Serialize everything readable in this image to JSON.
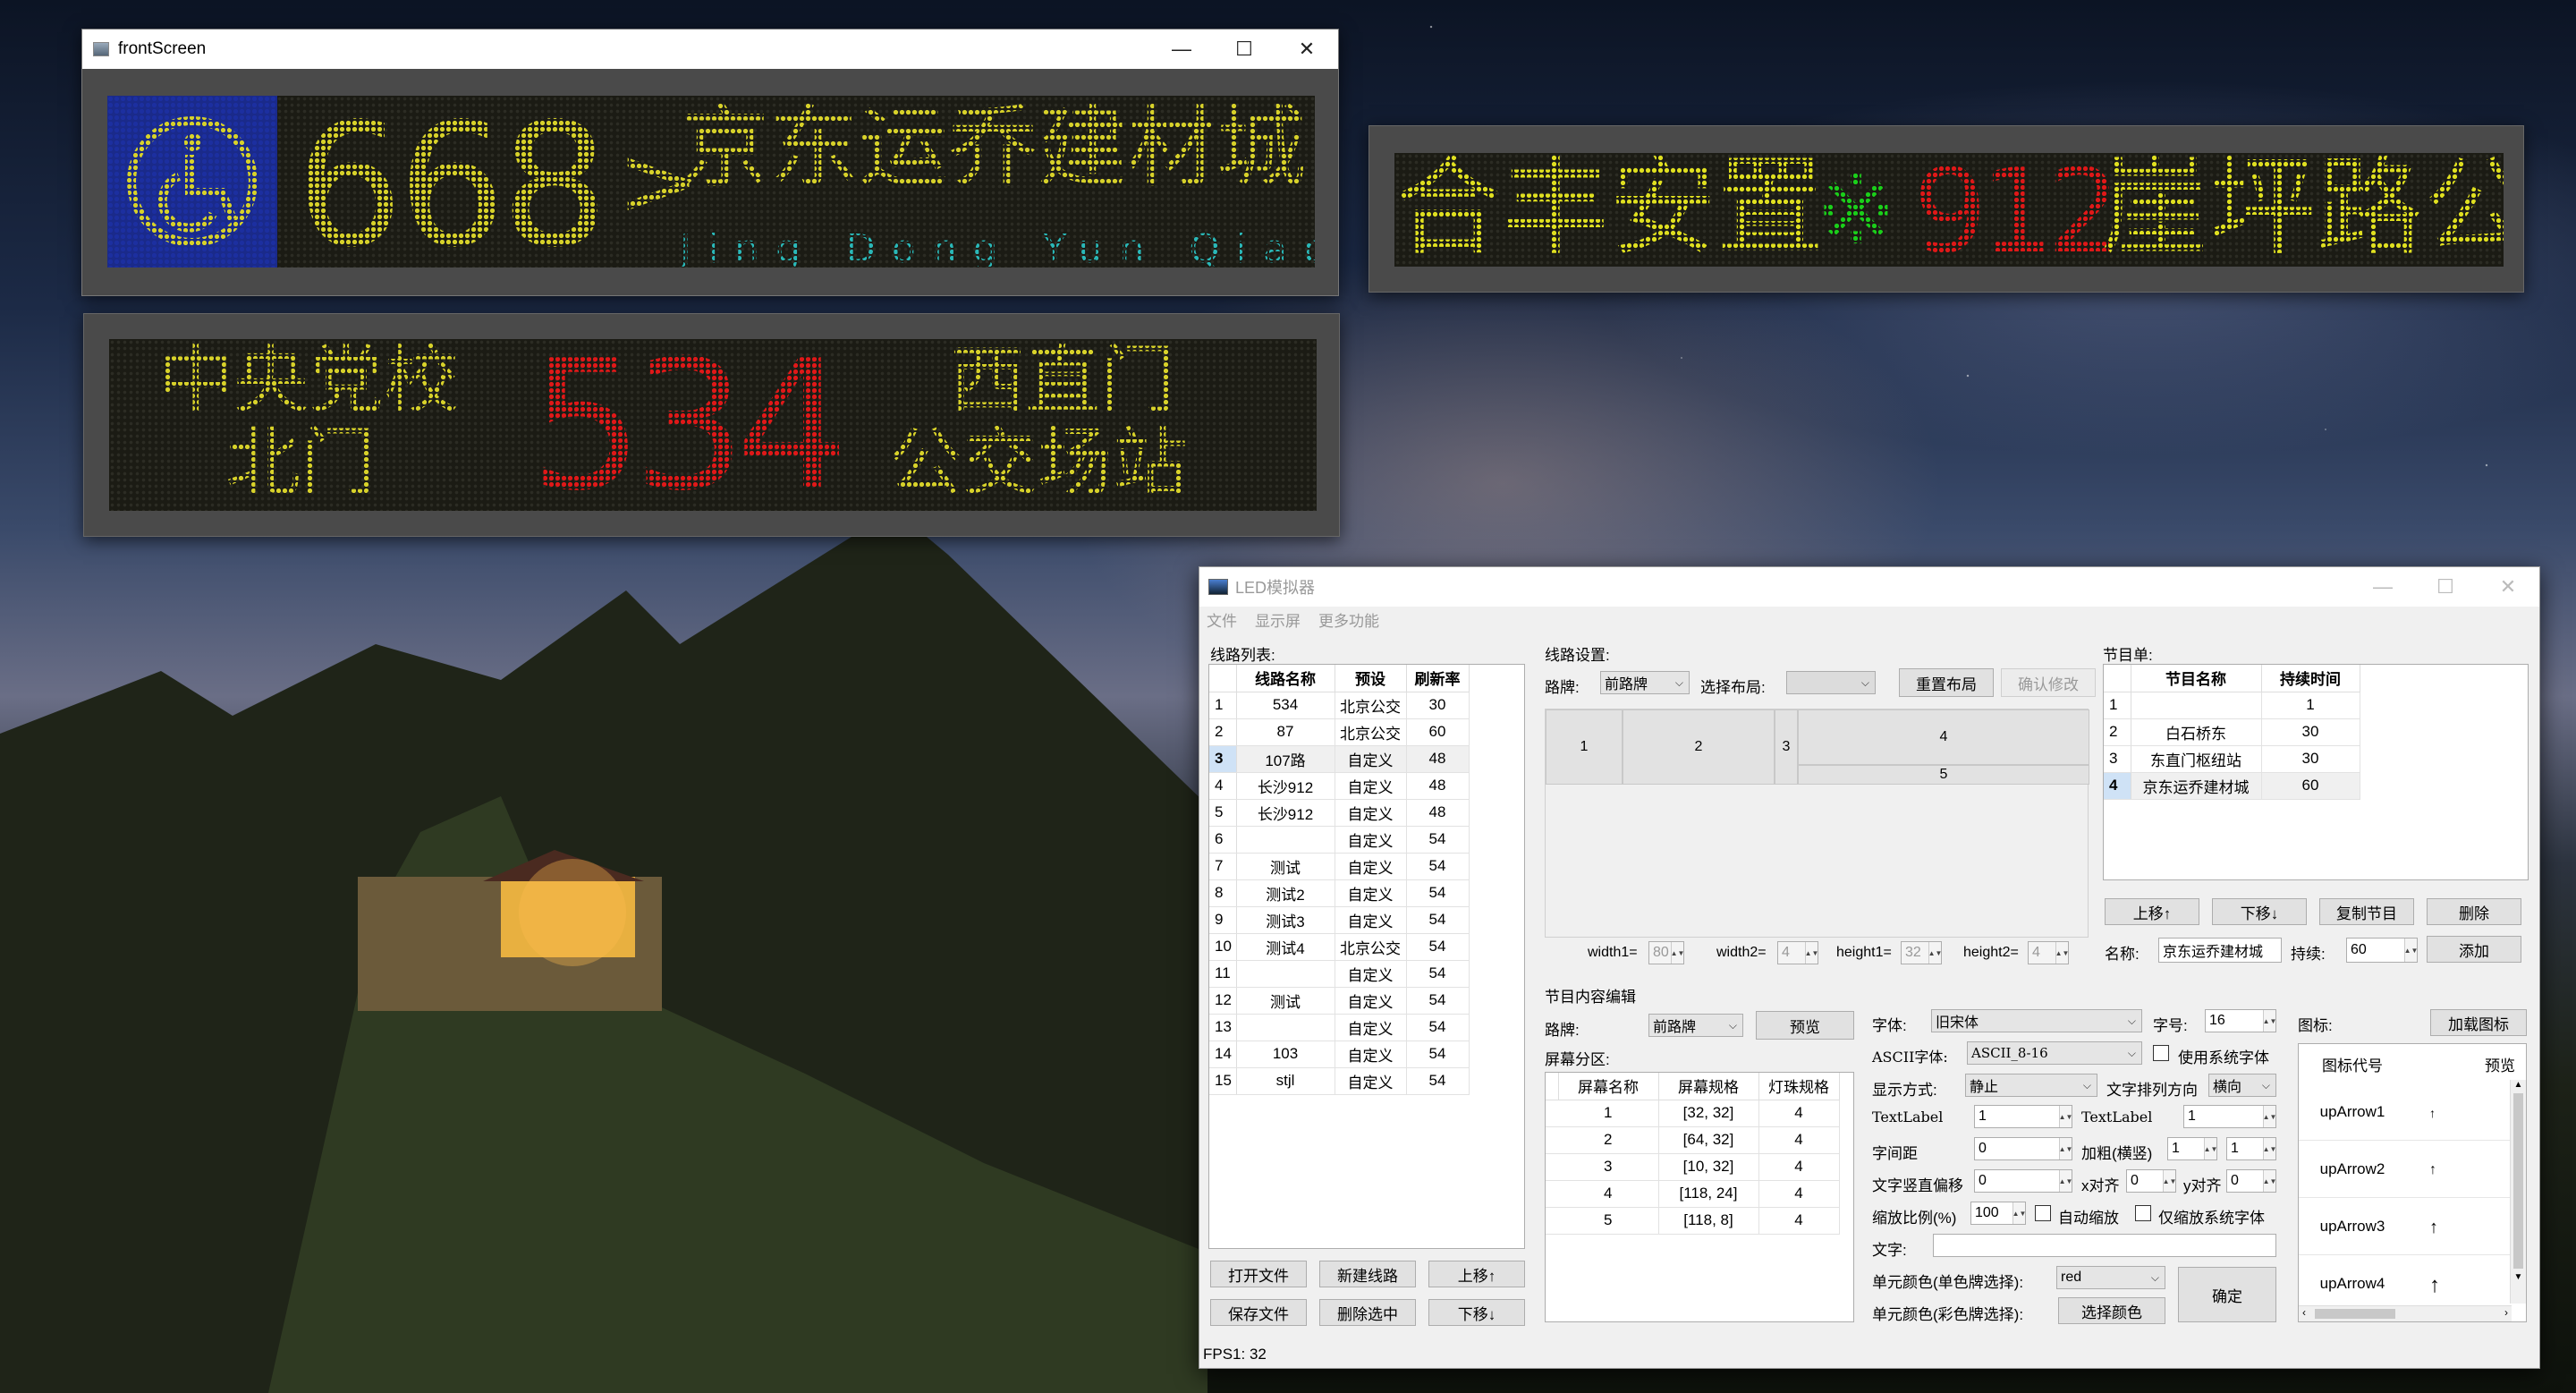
{
  "front_window": {
    "title": "frontScreen",
    "minimize": "—",
    "maximize": "☐",
    "close": "✕"
  },
  "led_front": {
    "number": "668",
    "arrow": ">",
    "dest": "京东运乔建材城",
    "pinyin": "Jing Dong Yun Qiao Bu",
    "colors": {
      "icon_bg": "#1a2a8a",
      "yellow": "#d8d22a",
      "cyan": "#2ab8b8"
    }
  },
  "led_right": {
    "prefix": "合丰安置",
    "star": "※",
    "number": "912",
    "suffix": "崖坪路公",
    "colors": {
      "yellow": "#e0e020",
      "green": "#1ad01a",
      "red": "#e01818"
    }
  },
  "led_bottom": {
    "left_line1": "中央党校",
    "left_line2": "北门",
    "number": "534",
    "right_line1": "西直门",
    "right_line2": "公交场站",
    "colors": {
      "yellow": "#d8d22a",
      "red": "#e01818"
    }
  },
  "app": {
    "title": "LED模拟器",
    "menu": [
      "文件",
      "显示屏",
      "更多功能"
    ],
    "route_list": {
      "label": "线路列表:",
      "headers": [
        "线路名称",
        "预设",
        "刷新率"
      ],
      "rows": [
        [
          "1",
          "534",
          "北京公交",
          "30"
        ],
        [
          "2",
          "87",
          "北京公交",
          "60"
        ],
        [
          "3",
          "107路",
          "自定义",
          "48"
        ],
        [
          "4",
          "长沙912",
          "自定义",
          "48"
        ],
        [
          "5",
          "长沙912",
          "自定义",
          "48"
        ],
        [
          "6",
          "",
          "自定义",
          "54"
        ],
        [
          "7",
          "测试",
          "自定义",
          "54"
        ],
        [
          "8",
          "测试2",
          "自定义",
          "54"
        ],
        [
          "9",
          "测试3",
          "自定义",
          "54"
        ],
        [
          "10",
          "测试4",
          "北京公交",
          "54"
        ],
        [
          "11",
          "",
          "自定义",
          "54"
        ],
        [
          "12",
          "测试",
          "自定义",
          "54"
        ],
        [
          "13",
          "",
          "自定义",
          "54"
        ],
        [
          "14",
          "103",
          "自定义",
          "54"
        ],
        [
          "15",
          "stjl",
          "自定义",
          "54"
        ]
      ],
      "selected_row": 3,
      "buttons": [
        "打开文件",
        "新建线路",
        "上移↑",
        "保存文件",
        "删除选中",
        "下移↓"
      ]
    },
    "route_settings": {
      "label": "线路设置:",
      "sign_label": "路牌:",
      "sign_value": "前路牌",
      "layout_label": "选择布局:",
      "layout_value": "",
      "reset_button": "重置布局",
      "confirm_button": "确认修改",
      "cells": [
        "1",
        "2",
        "3",
        "4",
        "5"
      ],
      "width1_label": "width1=",
      "width1": "80",
      "width2_label": "width2=",
      "width2": "4",
      "height1_label": "height1=",
      "height1": "32",
      "height2_label": "height2=",
      "height2": "4"
    },
    "program_list": {
      "label": "节目单:",
      "headers": [
        "节目名称",
        "持续时间"
      ],
      "rows": [
        [
          "1",
          "",
          "1"
        ],
        [
          "2",
          "白石桥东",
          "30"
        ],
        [
          "3",
          "东直门枢纽站",
          "30"
        ],
        [
          "4",
          "京东运乔建材城",
          "60"
        ]
      ],
      "selected_row": 4,
      "buttons": [
        "上移↑",
        "下移↓",
        "复制节目",
        "删除"
      ],
      "name_label": "名称:",
      "name_value": "京东运乔建材城",
      "duration_label": "持续:",
      "duration_value": "60",
      "add_button": "添加"
    },
    "content_edit": {
      "label": "节目内容编辑",
      "sign_label": "路牌:",
      "sign_value": "前路牌",
      "preview_button": "预览",
      "partition_label": "屏幕分区:",
      "headers": [
        "屏幕名称",
        "屏幕规格",
        "灯珠规格"
      ],
      "rows": [
        [
          "1",
          "[32, 32]",
          "4"
        ],
        [
          "2",
          "[64, 32]",
          "4"
        ],
        [
          "3",
          "[10, 32]",
          "4"
        ],
        [
          "4",
          "[118, 24]",
          "4"
        ],
        [
          "5",
          "[118, 8]",
          "4"
        ]
      ]
    },
    "font_settings": {
      "font_label": "字体:",
      "font_value": "旧宋体",
      "size_label": "字号:",
      "size_value": "16",
      "ascii_label": "ASCII字体:",
      "ascii_value": "ASCII_8-16",
      "system_font_label": "使用系统字体",
      "display_label": "显示方式:",
      "display_value": "静止",
      "direction_label": "文字排列方向",
      "direction_value": "横向",
      "textlabel1": "TextLabel",
      "textlabel1_value": "1",
      "textlabel2": "TextLabel",
      "textlabel2_value": "1",
      "spacing_label": "字间距",
      "spacing_value": "0",
      "bold_label": "加粗(横竖)",
      "bold_h": "1",
      "bold_v": "1",
      "voffset_label": "文字竖直偏移",
      "voffset_value": "0",
      "xalign_label": "x对齐",
      "xalign_value": "0",
      "yalign_label": "y对齐",
      "yalign_value": "0",
      "scale_label": "缩放比例(%)",
      "scale_value": "100",
      "autoscale_label": "自动缩放",
      "sysscale_label": "仅缩放系统字体",
      "text_label": "文字:",
      "text_value": "",
      "mono_color_label": "单元颜色(单色牌选择):",
      "mono_color_value": "red",
      "multi_color_label": "单元颜色(彩色牌选择):",
      "pick_color_button": "选择颜色",
      "ok_button": "确定"
    },
    "icons": {
      "label": "图标:",
      "load_button": "加载图标",
      "headers": [
        "图标代号",
        "预览"
      ],
      "rows": [
        "upArrow1",
        "upArrow2",
        "upArrow3",
        "upArrow4"
      ]
    },
    "fps": "FPS1: 32"
  }
}
